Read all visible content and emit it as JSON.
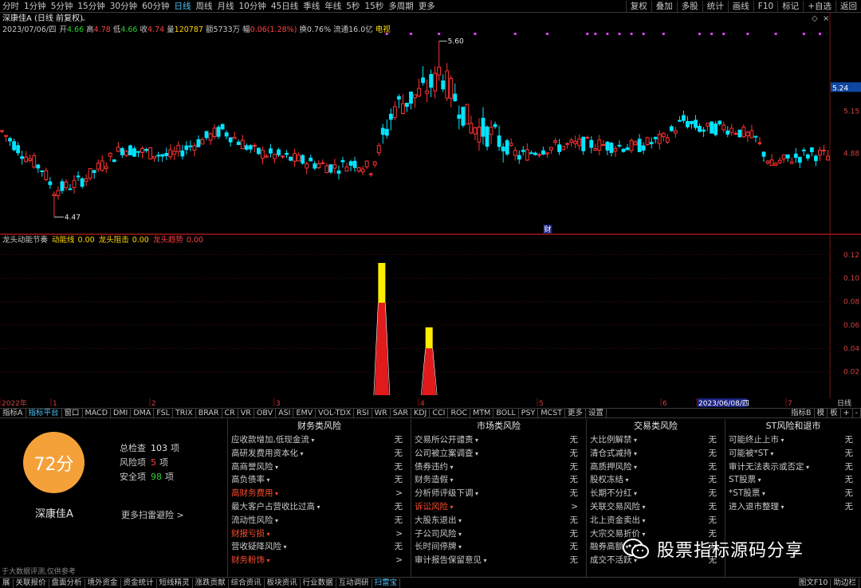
{
  "period_bar": {
    "tabs": [
      "分时",
      "1分钟",
      "5分钟",
      "15分钟",
      "30分钟",
      "60分钟",
      "日线",
      "周线",
      "月线",
      "10分钟",
      "45日线",
      "季线",
      "年线",
      "5秒",
      "15秒",
      "多周期",
      "更多"
    ],
    "active": "日线",
    "right_tabs": [
      "复权",
      "叠加",
      "多股",
      "统计",
      "画线",
      "F10",
      "标记",
      "+自选",
      "返回"
    ]
  },
  "stock": {
    "title": "深康佳A (日线 前复权)",
    "date": "2023/07/06/四",
    "quote": [
      {
        "label": "开",
        "value": "4.66",
        "color": "#2dd12d"
      },
      {
        "label": "高",
        "value": "4.78",
        "color": "#ff4040"
      },
      {
        "label": "低",
        "value": "4.66",
        "color": "#2dd12d"
      },
      {
        "label": "收",
        "value": "4.74",
        "color": "#ff4040"
      },
      {
        "label": "量",
        "value": "120787",
        "color": "#ffd700"
      },
      {
        "label": "额",
        "value": "5733万",
        "color": "#c8c8c8"
      },
      {
        "label": "幅",
        "value": "0.06(1.28%)",
        "color": "#ff4040"
      },
      {
        "label": "换",
        "value": "0.76%",
        "color": "#c8c8c8"
      },
      {
        "label": "流通",
        "value": "16.0亿",
        "color": "#c8c8c8"
      }
    ],
    "sector": "电视"
  },
  "main_chart": {
    "price_labels": [
      "5.24",
      "5.15",
      "4.88"
    ],
    "high_marker": "5.60",
    "low_marker": "4.47",
    "fin_marker": "财",
    "current_price": "5.24"
  },
  "indicator": {
    "name": "龙头动能节奏",
    "items": [
      {
        "label": "动能线",
        "value": "0.00",
        "color": "#ffd700"
      },
      {
        "label": "龙头阻击",
        "value": "0.00",
        "color": "#ffd700"
      },
      {
        "label": "龙头趋势",
        "value": "0.00",
        "color": "#ff4040"
      }
    ],
    "axis": [
      "0.12",
      "0.10",
      "0.08",
      "0.06",
      "0.04",
      "0.02"
    ],
    "spikes": [
      {
        "position": 0.46,
        "value": 0.113,
        "split": 0.079
      },
      {
        "position": 0.517,
        "value": 0.058,
        "split": 0.04
      }
    ]
  },
  "date_axis": {
    "labels": [
      "2022年",
      "1",
      "2",
      "3",
      "4",
      "5",
      "6",
      "2023/06/08/四",
      "7"
    ],
    "period_label": "日线"
  },
  "indicator_tabs": {
    "left": [
      "指标A",
      "指标平台",
      "窗口",
      "MACD",
      "DMI",
      "DMA",
      "FSL",
      "TRIX",
      "BRAR",
      "CR",
      "VR",
      "OBV",
      "ASI",
      "EMV",
      "VOL-TDX",
      "RSI",
      "WR",
      "SAR",
      "KDJ",
      "CCI",
      "ROC",
      "MTM",
      "BOLL",
      "PSY",
      "MCST",
      "更多",
      "设置"
    ],
    "active": "指标平台",
    "right": [
      "指标B",
      "模",
      "板",
      "+",
      "-"
    ]
  },
  "risk_panel": {
    "score": "72分",
    "stock_name": "深康佳A",
    "stats": [
      {
        "label": "总检查",
        "value": "103",
        "unit": "项",
        "color": "#e6e6e6"
      },
      {
        "label": "风险项",
        "value": "5",
        "unit": "项",
        "color": "#ff4040"
      },
      {
        "label": "安全项",
        "value": "98",
        "unit": "项",
        "color": "#2dd12d"
      }
    ],
    "more_link": "更多扫雷避险 >",
    "disclaimer": "于大数据评测,仅供参考",
    "columns": [
      {
        "title": "财务类风险",
        "items": [
          {
            "label": "应收款增加,低现金流",
            "status": "无",
            "hot": false
          },
          {
            "label": "高研发费用资本化",
            "status": "无",
            "hot": false
          },
          {
            "label": "高商誉风险",
            "status": "无",
            "hot": false
          },
          {
            "label": "高负债率",
            "status": "无",
            "hot": false
          },
          {
            "label": "高财务费用",
            "status": ">",
            "hot": true
          },
          {
            "label": "最大客户占营收比过高",
            "status": "无",
            "hot": false
          },
          {
            "label": "流动性风险",
            "status": "无",
            "hot": false
          },
          {
            "label": "财报亏损",
            "status": ">",
            "hot": true
          },
          {
            "label": "营收疑降风险",
            "status": "无",
            "hot": false
          },
          {
            "label": "财务粉饰",
            "status": ">",
            "hot": true
          }
        ]
      },
      {
        "title": "市场类风险",
        "items": [
          {
            "label": "交易所公开谴责",
            "status": "无",
            "hot": false
          },
          {
            "label": "公司被立案调查",
            "status": "无",
            "hot": false
          },
          {
            "label": "债券违约",
            "status": "无",
            "hot": false
          },
          {
            "label": "财务造假",
            "status": "无",
            "hot": false
          },
          {
            "label": "分析师评级下调",
            "status": "无",
            "hot": false
          },
          {
            "label": "诉讼风险",
            "status": ">",
            "hot": true
          },
          {
            "label": "大股东退出",
            "status": "无",
            "hot": false
          },
          {
            "label": "子公司风险",
            "status": "无",
            "hot": false
          },
          {
            "label": "长时间停牌",
            "status": "无",
            "hot": false
          },
          {
            "label": "审计报告保留意见",
            "status": "无",
            "hot": false
          }
        ]
      },
      {
        "title": "交易类风险",
        "items": [
          {
            "label": "大比例解禁",
            "status": "无",
            "hot": false
          },
          {
            "label": "清仓式减持",
            "status": "无",
            "hot": false
          },
          {
            "label": "高质押风险",
            "status": "无",
            "hot": false
          },
          {
            "label": "股权冻结",
            "status": "无",
            "hot": false
          },
          {
            "label": "长期不分红",
            "status": "无",
            "hot": false
          },
          {
            "label": "关联交易风险",
            "status": "无",
            "hot": false
          },
          {
            "label": "北上资金卖出",
            "status": "无",
            "hot": false
          },
          {
            "label": "大宗交易折价",
            "status": "无",
            "hot": false
          },
          {
            "label": "融券高额",
            "status": "无",
            "hot": false
          },
          {
            "label": "成交不活跃",
            "status": "无",
            "hot": false
          }
        ]
      },
      {
        "title": "ST风险和退市",
        "items": [
          {
            "label": "可能终止上市",
            "status": "无",
            "hot": false
          },
          {
            "label": "可能被*ST",
            "status": "无",
            "hot": false
          },
          {
            "label": "审计无法表示或否定",
            "status": "无",
            "hot": false
          },
          {
            "label": "ST股票",
            "status": "无",
            "hot": false
          },
          {
            "label": "*ST股票",
            "status": "无",
            "hot": false
          },
          {
            "label": "进入退市整理",
            "status": "无",
            "hot": false
          }
        ]
      }
    ]
  },
  "nav_bar": {
    "tabs": [
      "展",
      "关联报价",
      "盘面分析",
      "境外资金",
      "资金统计",
      "短线精灵",
      "涨跌贡献",
      "综合资讯",
      "板块资讯",
      "行业数据",
      "互动调研",
      "扫雷宝"
    ],
    "active": "扫雷宝",
    "right": [
      "图文F10",
      "助边栏"
    ]
  },
  "watermark": {
    "text": "股票指标源码分享"
  },
  "colors": {
    "up": "#ff3333",
    "down": "#00e5ff",
    "grid": "#7a1010",
    "accent": "#4fc3f7"
  }
}
